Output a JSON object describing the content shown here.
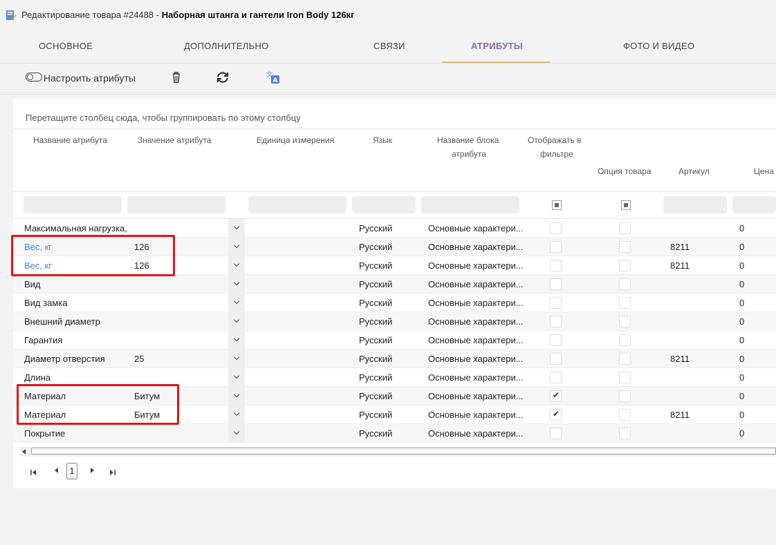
{
  "window": {
    "title_prefix": "Редактирование товара #24488 - ",
    "title_bold": "Наборная штанга и гантели Iron Body 126кг"
  },
  "tabs": [
    {
      "label": "ОСНОВНОЕ",
      "active": false
    },
    {
      "label": "ДОПОЛНИТЕЛЬНО",
      "active": false
    },
    {
      "label": "СВЯЗИ",
      "active": false
    },
    {
      "label": "АТРИБУТЫ",
      "active": true
    },
    {
      "label": "ФОТО И ВИДЕО",
      "active": false
    }
  ],
  "toolbar": {
    "configure_label": "Настроить атрибуты",
    "icons": [
      "toggle-icon",
      "trash-icon",
      "refresh-icon",
      "translate-icon"
    ]
  },
  "grid": {
    "group_hint": "Перетащите столбец сюда, чтобы группировать по этому столбцу",
    "columns": {
      "name": "Название атрибута",
      "value": "Значение атрибута",
      "unit": "Единица измерения",
      "lang": "Язык",
      "block_l1": "Название блока",
      "block_l2": "атрибута",
      "filter_l1": "Отображать в",
      "filter_l2": "фильтре",
      "option": "Опция товара",
      "article": "Артикул",
      "price": "Цена"
    },
    "rows": [
      {
        "name": "Максимальная нагрузка,",
        "value": "",
        "lang": "Русский",
        "block": "Основные характери...",
        "filter": false,
        "option": false,
        "article": "",
        "price": "0",
        "link": false
      },
      {
        "name": "Вес, кг",
        "value": "126",
        "lang": "Русский",
        "block": "Основные характери...",
        "filter": false,
        "option": false,
        "article": "8211",
        "price": "0",
        "link": true
      },
      {
        "name": "Вес, кг",
        "value": "126",
        "lang": "Русский",
        "block": "Основные характери...",
        "filter": false,
        "option": false,
        "article": "8211",
        "price": "0",
        "link": true
      },
      {
        "name": "Вид",
        "value": "",
        "lang": "Русский",
        "block": "Основные характери...",
        "filter": false,
        "option": false,
        "article": "",
        "price": "0",
        "link": false
      },
      {
        "name": "Вид замка",
        "value": "",
        "lang": "Русский",
        "block": "Основные характери...",
        "filter": false,
        "option": false,
        "article": "",
        "price": "0",
        "link": false
      },
      {
        "name": "Внешний диаметр",
        "value": "",
        "lang": "Русский",
        "block": "Основные характери...",
        "filter": false,
        "option": false,
        "article": "",
        "price": "0",
        "link": false
      },
      {
        "name": "Гарантия",
        "value": "",
        "lang": "Русский",
        "block": "Основные характери...",
        "filter": false,
        "option": false,
        "article": "",
        "price": "0",
        "link": false
      },
      {
        "name": "Диаметр отверстия",
        "value": "25",
        "lang": "Русский",
        "block": "Основные характери...",
        "filter": false,
        "option": false,
        "article": "8211",
        "price": "0",
        "link": false
      },
      {
        "name": "Длина",
        "value": "",
        "lang": "Русский",
        "block": "Основные характери...",
        "filter": false,
        "option": false,
        "article": "",
        "price": "0",
        "link": false
      },
      {
        "name": "Материал",
        "value": "Битум",
        "lang": "Русский",
        "block": "Основные характери...",
        "filter": true,
        "option": false,
        "article": "",
        "price": "0",
        "link": false
      },
      {
        "name": "Материал",
        "value": "Битум",
        "lang": "Русский",
        "block": "Основные характери...",
        "filter": true,
        "option": false,
        "article": "8211",
        "price": "0",
        "link": false
      },
      {
        "name": "Покрытие",
        "value": "",
        "lang": "Русский",
        "block": "Основные характери...",
        "filter": false,
        "option": false,
        "article": "",
        "price": "0",
        "link": false
      }
    ]
  },
  "pager": {
    "current_page": "1"
  },
  "colors": {
    "accent_tab": "#8a6bb0",
    "tab_underline": "#e8b878",
    "highlight": "#e8111a",
    "link": "#3a86d8"
  }
}
